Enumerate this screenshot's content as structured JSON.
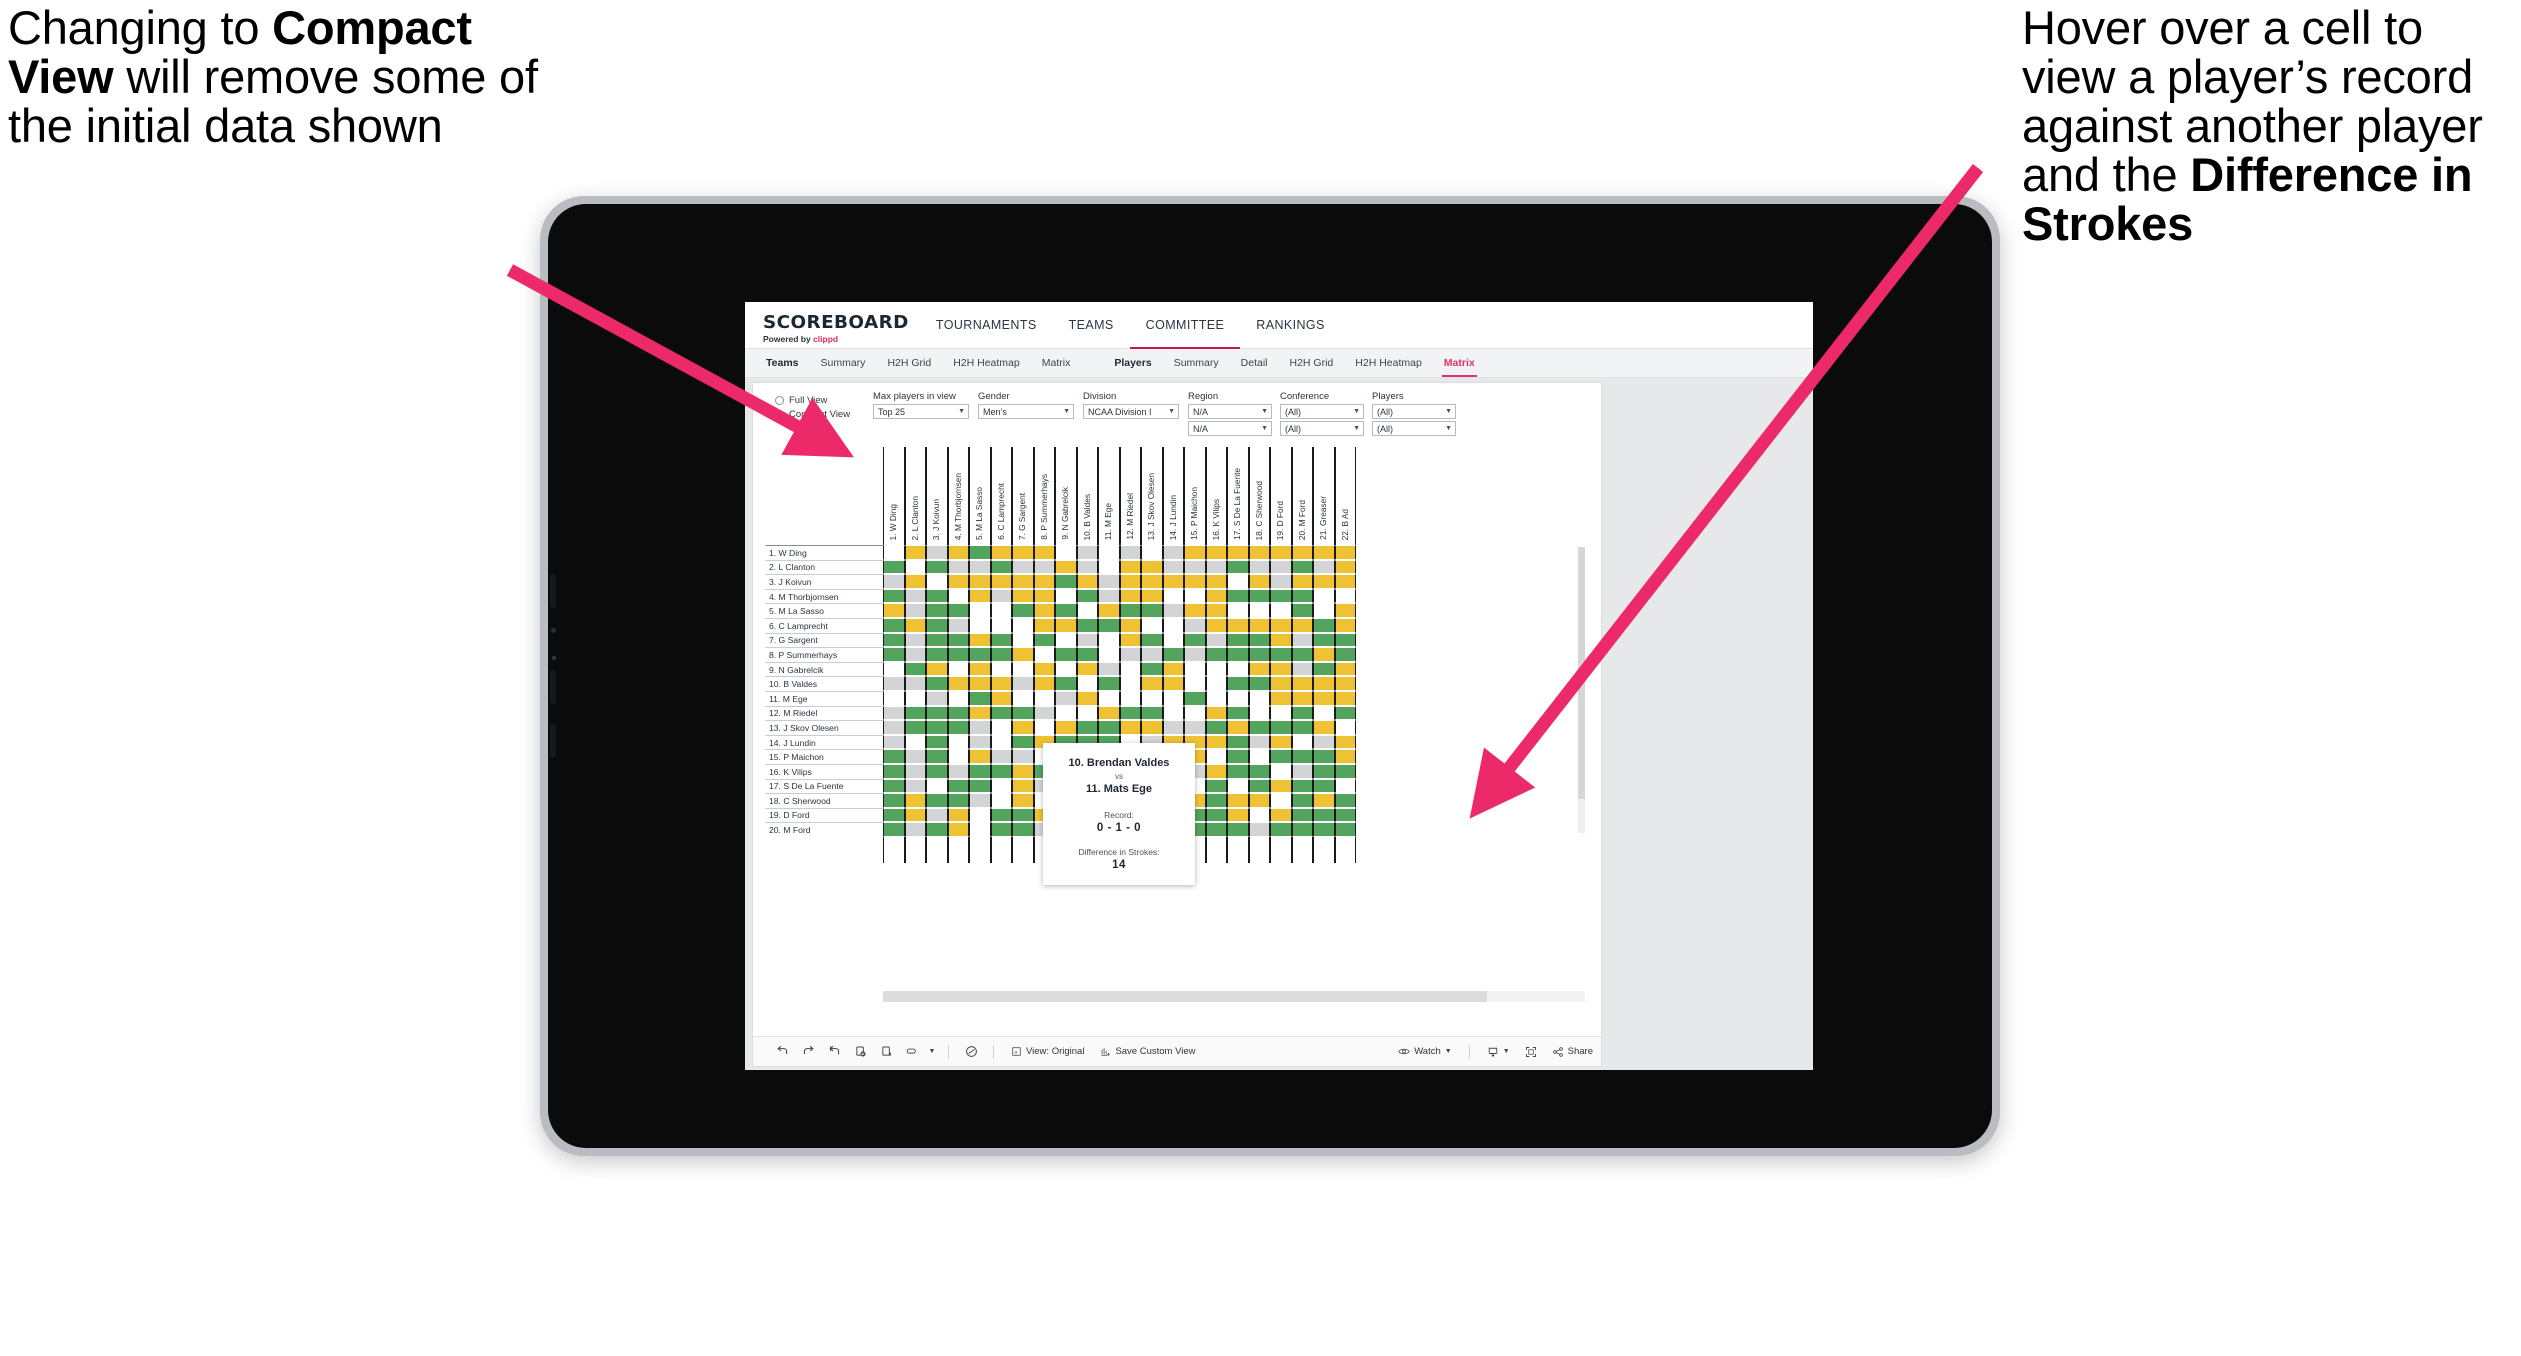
{
  "annotations": {
    "left": {
      "pre": "Changing to ",
      "bold": "Compact View",
      "post": " will remove some of the initial data shown"
    },
    "right": {
      "pre": "Hover over a cell to view a player’s record against another player and the ",
      "bold": "Difference in Strokes",
      "post": ""
    },
    "arrow_color": "#ec2a6a"
  },
  "brand": {
    "title": "SCOREBOARD",
    "sub_pre": "Powered by ",
    "sub_brand": "clippd",
    "accent": "#e9295f"
  },
  "topnav": [
    {
      "label": "TOURNAMENTS",
      "active": false
    },
    {
      "label": "TEAMS",
      "active": false
    },
    {
      "label": "COMMITTEE",
      "active": true
    },
    {
      "label": "RANKINGS",
      "active": false
    }
  ],
  "subnav": {
    "group1": [
      "Teams",
      "Summary",
      "H2H Grid",
      "H2H Heatmap",
      "Matrix"
    ],
    "group2": [
      "Players",
      "Summary",
      "Detail",
      "H2H Grid",
      "H2H Heatmap",
      "Matrix"
    ],
    "selected": "Matrix"
  },
  "filters": {
    "view_options": [
      {
        "label": "Full View",
        "selected": false
      },
      {
        "label": "Compact View",
        "selected": true
      }
    ],
    "fields": [
      {
        "label": "Max players in view",
        "value": "Top 25",
        "second": null
      },
      {
        "label": "Gender",
        "value": "Men’s",
        "second": null
      },
      {
        "label": "Division",
        "value": "NCAA Division I",
        "second": null
      },
      {
        "label": "Region",
        "value": "N/A",
        "second": "N/A"
      },
      {
        "label": "Conference",
        "value": "(All)",
        "second": "(All)"
      },
      {
        "label": "Players",
        "value": "(All)",
        "second": "(All)"
      }
    ]
  },
  "matrix": {
    "rows": [
      "1. W Ding",
      "2. L Clanton",
      "3. J Koivun",
      "4. M Thorbjornsen",
      "5. M La Sasso",
      "6. C Lamprecht",
      "7. G Sargent",
      "8. P Summerhays",
      "9. N Gabrelcik",
      "10. B Valdes",
      "11. M Ege",
      "12. M Riedel",
      "13. J Skov Olesen",
      "14. J Lundin",
      "15. P Maichon",
      "16. K Vilips",
      "17. S De La Fuente",
      "18. C Sherwood",
      "19. D Ford",
      "20. M Ford"
    ],
    "cols": [
      "1. W Ding",
      "2. L Clanton",
      "3. J Koivun",
      "4. M Thorbjornsen",
      "5. M La Sasso",
      "6. C Lamprecht",
      "7. G Sargent",
      "8. P Summerhays",
      "9. N Gabrelcik",
      "10. B Valdes",
      "11. M Ege",
      "12. M Riedel",
      "13. J Skov Olesen",
      "14. J Lundin",
      "15. P Maichon",
      "16. K Vilips",
      "17. S De La Fuente",
      "18. C Sherwood",
      "19. D Ford",
      "20. M Ford",
      "21. Greaser",
      "22. B Ad"
    ],
    "legend": {
      "win": "#53a45c",
      "loss": "#efc233",
      "tie": "#d2d4d6",
      "none": "#ffffff"
    },
    "cells": [
      [
        "w",
        "y",
        "a",
        "y",
        "g",
        "y",
        "y",
        "y",
        "w",
        "a",
        "w",
        "a",
        "w",
        "a",
        "y",
        "y",
        "y",
        "y",
        "y",
        "y",
        "y",
        "y"
      ],
      [
        "g",
        "w",
        "g",
        "a",
        "a",
        "g",
        "a",
        "a",
        "y",
        "a",
        "w",
        "y",
        "y",
        "a",
        "a",
        "a",
        "g",
        "a",
        "a",
        "g",
        "a",
        "y"
      ],
      [
        "a",
        "y",
        "w",
        "y",
        "y",
        "y",
        "y",
        "y",
        "g",
        "y",
        "a",
        "y",
        "y",
        "y",
        "y",
        "y",
        "w",
        "y",
        "a",
        "y",
        "y",
        "y"
      ],
      [
        "g",
        "a",
        "g",
        "w",
        "y",
        "a",
        "y",
        "y",
        "w",
        "g",
        "a",
        "y",
        "y",
        "w",
        "w",
        "y",
        "g",
        "g",
        "g",
        "g",
        "w",
        "w"
      ],
      [
        "y",
        "a",
        "g",
        "g",
        "w",
        "w",
        "g",
        "y",
        "g",
        "w",
        "y",
        "g",
        "g",
        "a",
        "y",
        "y",
        "w",
        "w",
        "w",
        "g",
        "w",
        "y"
      ],
      [
        "g",
        "y",
        "g",
        "a",
        "w",
        "w",
        "w",
        "y",
        "y",
        "g",
        "g",
        "y",
        "w",
        "w",
        "a",
        "y",
        "y",
        "y",
        "y",
        "y",
        "g",
        "y"
      ],
      [
        "g",
        "a",
        "g",
        "g",
        "y",
        "g",
        "w",
        "g",
        "w",
        "a",
        "w",
        "y",
        "g",
        "w",
        "g",
        "a",
        "g",
        "g",
        "y",
        "a",
        "g",
        "g"
      ],
      [
        "g",
        "a",
        "g",
        "g",
        "g",
        "g",
        "y",
        "w",
        "g",
        "g",
        "w",
        "a",
        "a",
        "g",
        "a",
        "g",
        "g",
        "g",
        "g",
        "g",
        "y",
        "g"
      ],
      [
        "w",
        "g",
        "y",
        "w",
        "y",
        "w",
        "w",
        "y",
        "w",
        "y",
        "a",
        "w",
        "g",
        "y",
        "w",
        "w",
        "w",
        "y",
        "y",
        "a",
        "g",
        "y"
      ],
      [
        "a",
        "a",
        "g",
        "y",
        "y",
        "y",
        "a",
        "y",
        "g",
        "w",
        "g",
        "w",
        "y",
        "y",
        "w",
        "w",
        "g",
        "g",
        "y",
        "y",
        "y",
        "y"
      ],
      [
        "w",
        "w",
        "a",
        "w",
        "g",
        "y",
        "w",
        "w",
        "a",
        "y",
        "w",
        "w",
        "w",
        "w",
        "g",
        "w",
        "w",
        "w",
        "y",
        "y",
        "y",
        "y"
      ],
      [
        "a",
        "g",
        "g",
        "g",
        "y",
        "g",
        "g",
        "a",
        "w",
        "w",
        "y",
        "g",
        "g",
        "w",
        "w",
        "y",
        "g",
        "w",
        "w",
        "g",
        "w",
        "g"
      ],
      [
        "a",
        "g",
        "g",
        "g",
        "a",
        "w",
        "y",
        "w",
        "y",
        "g",
        "g",
        "y",
        "y",
        "a",
        "a",
        "g",
        "y",
        "g",
        "g",
        "g",
        "y",
        "w"
      ],
      [
        "a",
        "w",
        "g",
        "w",
        "a",
        "w",
        "g",
        "y",
        "g",
        "g",
        "g",
        "w",
        "a",
        "y",
        "y",
        "y",
        "g",
        "a",
        "y",
        "w",
        "a",
        "y"
      ],
      [
        "g",
        "a",
        "g",
        "w",
        "y",
        "a",
        "a",
        "w",
        "g",
        "w",
        "w",
        "y",
        "g",
        "g",
        "y",
        "w",
        "g",
        "w",
        "g",
        "g",
        "g",
        "y"
      ],
      [
        "g",
        "a",
        "g",
        "a",
        "g",
        "g",
        "y",
        "g",
        "g",
        "w",
        "w",
        "w",
        "g",
        "g",
        "a",
        "y",
        "g",
        "g",
        "w",
        "a",
        "g",
        "g"
      ],
      [
        "g",
        "a",
        "w",
        "g",
        "g",
        "w",
        "y",
        "a",
        "w",
        "y",
        "a",
        "y",
        "y",
        "y",
        "w",
        "g",
        "w",
        "g",
        "y",
        "g",
        "g",
        "w"
      ],
      [
        "g",
        "y",
        "g",
        "g",
        "a",
        "w",
        "y",
        "w",
        "y",
        "w",
        "y",
        "g",
        "y",
        "w",
        "y",
        "g",
        "y",
        "y",
        "w",
        "g",
        "y",
        "g"
      ],
      [
        "g",
        "y",
        "a",
        "y",
        "w",
        "g",
        "g",
        "y",
        "g",
        "y",
        "g",
        "a",
        "g",
        "y",
        "g",
        "g",
        "y",
        "w",
        "y",
        "g",
        "g",
        "g"
      ],
      [
        "g",
        "a",
        "g",
        "y",
        "w",
        "g",
        "g",
        "a",
        "g",
        "g",
        "a",
        "g",
        "a",
        "g",
        "g",
        "g",
        "g",
        "a",
        "g",
        "g",
        "g",
        "g"
      ]
    ]
  },
  "tooltip": {
    "player_a": "10. Brendan Valdes",
    "vs": "vs",
    "player_b": "11. Mats Ege",
    "record_label": "Record:",
    "record_value": "0 - 1 - 0",
    "strokes_label": "Difference in Strokes:",
    "strokes_value": "14"
  },
  "toolbar": {
    "icons": [
      "undo-icon",
      "redo-icon",
      "revert-icon",
      "refresh-icon",
      "pause-icon",
      "highlight-icon",
      "caret-icon",
      "help-icon"
    ],
    "view_label": "View: Original",
    "save_label": "Save Custom View",
    "watch_label": "Watch",
    "share_label": "Share"
  }
}
